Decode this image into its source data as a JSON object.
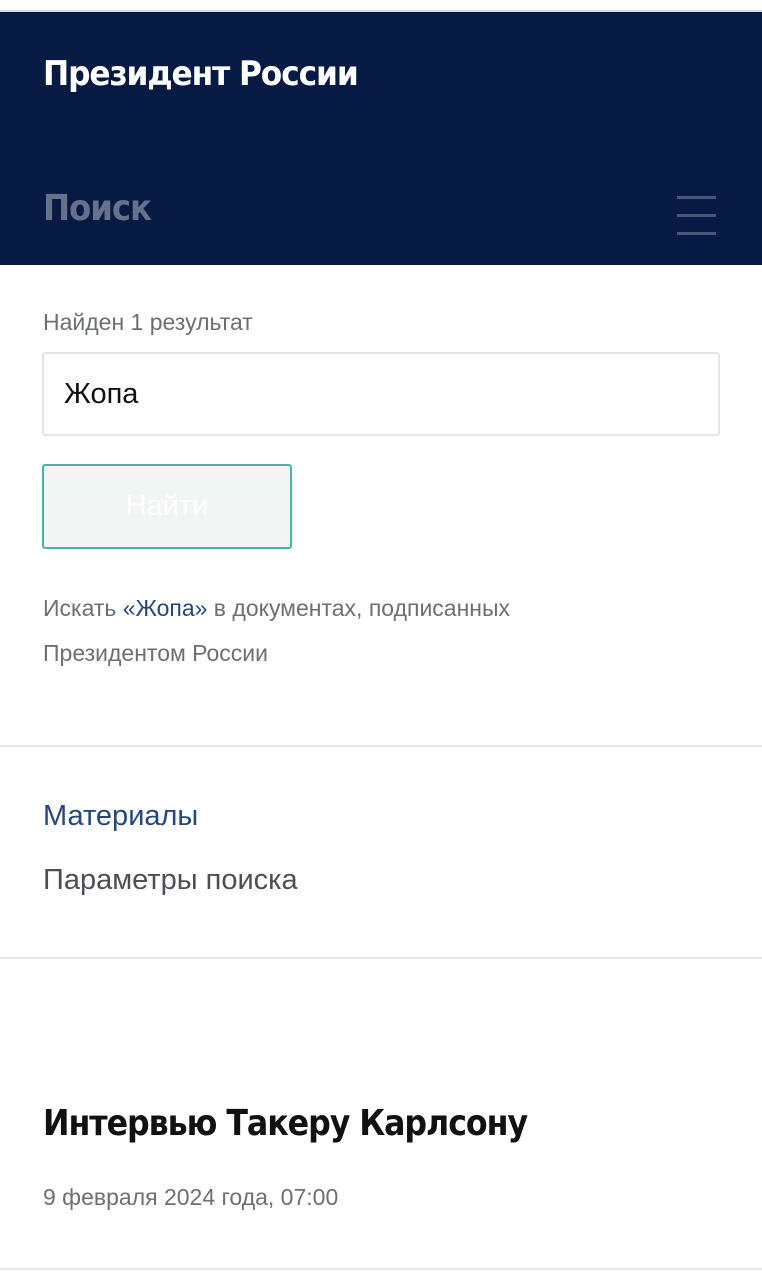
{
  "header": {
    "site_title": "Президент России",
    "section_title": "Поиск",
    "menu_icon": "hamburger-menu-icon"
  },
  "search": {
    "results_count": "Найден 1 результат",
    "query_value": "Жопа",
    "button_label": "Найти",
    "docs_prefix": "Искать ",
    "docs_query": "«Жопа»",
    "docs_suffix": " в документах, подписанных",
    "docs_line2": "Президентом России"
  },
  "tabs": {
    "materials": "Материалы",
    "search_params": "Параметры поиска"
  },
  "results": [
    {
      "title": "Интервью Такеру Карлсону",
      "date": "9 февраля 2024 года, 07:00"
    }
  ],
  "colors": {
    "header_bg": "#061a44",
    "link": "#25477c",
    "button_border": "#49b3a7"
  }
}
